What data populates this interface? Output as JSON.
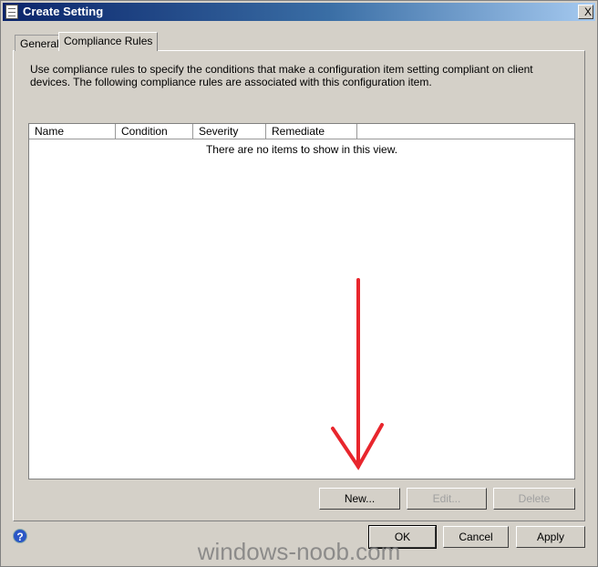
{
  "window": {
    "title": "Create Setting",
    "close_label": "X"
  },
  "tabs": [
    {
      "label": "General",
      "active": false
    },
    {
      "label": "Compliance Rules",
      "active": true
    }
  ],
  "description": "Use compliance rules to specify the conditions that make a configuration item setting compliant on client devices. The following compliance rules are associated with this configuration item.",
  "table": {
    "columns": [
      "Name",
      "Condition",
      "Severity",
      "Remediate"
    ],
    "empty_text": "There are no items to show in this view."
  },
  "rule_buttons": {
    "new": "New...",
    "edit": "Edit...",
    "delete": "Delete"
  },
  "dialog_buttons": {
    "ok": "OK",
    "cancel": "Cancel",
    "apply": "Apply"
  },
  "help_icon": "?",
  "watermark": "windows-noob.com",
  "annotation": {
    "color": "#e8262d",
    "icon": "arrow-down"
  }
}
